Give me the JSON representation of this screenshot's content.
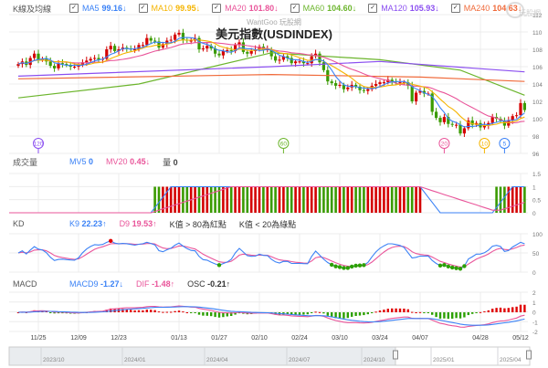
{
  "legend": {
    "label": "K線及均線",
    "items": [
      {
        "name": "MA5",
        "value": "99.16",
        "arrow": "↓",
        "color": "#3b82f6"
      },
      {
        "name": "MA10",
        "value": "99.95",
        "arrow": "↓",
        "color": "#f5b400"
      },
      {
        "name": "MA20",
        "value": "101.80",
        "arrow": "↓",
        "color": "#e9559a"
      },
      {
        "name": "MA60",
        "value": "104.60",
        "arrow": "↓",
        "color": "#6cb52d"
      },
      {
        "name": "MA120",
        "value": "105.93",
        "arrow": "↓",
        "color": "#8b4ff0"
      },
      {
        "name": "MA240",
        "value": "104.63",
        "arrow": "↓",
        "color": "#f06a3a"
      }
    ]
  },
  "logo": {
    "text": "玩股網"
  },
  "watermark": "WantGoo 玩股網",
  "title": "美元指數(USDINDEX)",
  "volume_header": {
    "label": "成交量",
    "mv5": {
      "name": "MV5",
      "value": "0",
      "arrow": "",
      "color": "#3b82f6"
    },
    "mv20": {
      "name": "MV20",
      "value": "0.45",
      "arrow": "↓",
      "color": "#e9559a"
    },
    "vol": {
      "name": "量",
      "value": "0",
      "arrow": "",
      "color": "#444"
    }
  },
  "kd_header": {
    "label": "KD",
    "k9": {
      "name": "K9",
      "value": "22.23",
      "arrow": "↑",
      "color": "#3b82f6"
    },
    "d9": {
      "name": "D9",
      "value": "19.53",
      "arrow": "↑",
      "color": "#e9559a"
    },
    "note_red": "K值 > 80為紅點",
    "note_green": "K值 < 20為綠點"
  },
  "macd_header": {
    "label": "MACD",
    "macd9": {
      "name": "MACD9",
      "value": "-1.27",
      "arrow": "↓",
      "color": "#3b82f6"
    },
    "dif": {
      "name": "DIF",
      "value": "-1.48",
      "arrow": "↑",
      "color": "#e9559a"
    },
    "osc": {
      "name": "OSC",
      "value": "-0.21",
      "arrow": "↑",
      "color": "#444"
    }
  },
  "colors": {
    "up": "#d40000",
    "down": "#3a9b00",
    "grid": "#ececec"
  },
  "chart_data": {
    "type": "candlestick",
    "y_ticks": [
      "112",
      "110",
      "108",
      "106",
      "104",
      "102",
      "100",
      "98",
      "96"
    ],
    "ylim": [
      96,
      112
    ],
    "closes": [
      106.3,
      106.6,
      106.2,
      107.0,
      107.5,
      106.8,
      106.9,
      106.6,
      106.1,
      105.8,
      106.4,
      106.3,
      106.2,
      106.0,
      106.0,
      106.2,
      106.5,
      106.7,
      106.9,
      107.0,
      106.8,
      106.9,
      108.0,
      108.4,
      107.8,
      108.0,
      108.2,
      108.1,
      108.0,
      108.0,
      108.5,
      108.5,
      109.3,
      109.0,
      108.9,
      108.2,
      108.6,
      109.0,
      109.1,
      109.7,
      109.9,
      109.1,
      109.0,
      109.0,
      109.3,
      108.0,
      108.1,
      108.4,
      108.1,
      107.5,
      107.3,
      107.8,
      107.9,
      107.8,
      108.5,
      108.8,
      107.7,
      107.5,
      107.8,
      108.0,
      108.3,
      107.9,
      108.0,
      107.2,
      106.7,
      106.8,
      107.2,
      107.0,
      106.4,
      106.6,
      106.6,
      106.4,
      106.4,
      107.2,
      107.5,
      106.5,
      105.6,
      104.3,
      104.1,
      103.8,
      103.9,
      103.4,
      103.6,
      103.9,
      103.7,
      103.3,
      103.2,
      103.4,
      103.8,
      104.0,
      104.2,
      104.2,
      104.5,
      104.3,
      104.2,
      104.2,
      104.2,
      103.8,
      102.0,
      103.0,
      103.2,
      102.9,
      102.9,
      100.8,
      100.1,
      99.6,
      100.2,
      99.4,
      99.3,
      99.3,
      98.3,
      98.9,
      99.8,
      99.3,
      99.5,
      99.0,
      99.2,
      99.5,
      100.2,
      100.0,
      99.8,
      99.2,
      99.8,
      100.3,
      100.4,
      101.8,
      101.0
    ],
    "long_ma": {
      "MA60": [
        [
          0,
          102.4
        ],
        [
          30,
          104.0
        ],
        [
          63,
          107.6
        ],
        [
          90,
          106.8
        ],
        [
          110,
          105.6
        ],
        [
          126,
          102.7
        ]
      ],
      "MA120": [
        [
          0,
          104.9
        ],
        [
          63,
          106.0
        ],
        [
          90,
          106.6
        ],
        [
          126,
          105.4
        ]
      ],
      "MA240": [
        [
          0,
          104.6
        ],
        [
          63,
          105.1
        ],
        [
          100,
          104.8
        ],
        [
          126,
          104.3
        ]
      ]
    },
    "ma_markers": [
      {
        "label": "120",
        "index": 5,
        "color": "#8b4ff0"
      },
      {
        "label": "60",
        "index": 66,
        "color": "#6cb52d"
      },
      {
        "label": "20",
        "index": 106,
        "color": "#e9559a"
      },
      {
        "label": "10",
        "index": 116,
        "color": "#f5b400"
      },
      {
        "label": "5",
        "index": 121,
        "color": "#3b82f6"
      }
    ],
    "volume": [
      0,
      0,
      0,
      0,
      0,
      0,
      0,
      0,
      0,
      0,
      0,
      0,
      0,
      0,
      0,
      0,
      0,
      0,
      0,
      0,
      0,
      0,
      0,
      0,
      0,
      0,
      0,
      0,
      0,
      0,
      0,
      0,
      0,
      0,
      1,
      1,
      1,
      1,
      1,
      1,
      1,
      1,
      1,
      1,
      1,
      1,
      1,
      1,
      1,
      1,
      1,
      1,
      1,
      1,
      1,
      1,
      1,
      1,
      1,
      1,
      1,
      1,
      1,
      1,
      1,
      1,
      1,
      1,
      1,
      1,
      1,
      1,
      1,
      1,
      1,
      1,
      1,
      1,
      1,
      1,
      1,
      1,
      1,
      1,
      1,
      1,
      1,
      1,
      1,
      1,
      1,
      1,
      1,
      1,
      1,
      1,
      1,
      1,
      1,
      1,
      1,
      0,
      0,
      0,
      0,
      0,
      0,
      0,
      0,
      0,
      0,
      0,
      0,
      0,
      0,
      0,
      0,
      0,
      0,
      1,
      1,
      1,
      1,
      1,
      1,
      1,
      1
    ],
    "volume_ticks": [
      "1.5",
      "1",
      "0.5",
      "0"
    ],
    "kd_ticks": [
      "100",
      "50",
      "0"
    ],
    "macd_ticks": [
      "2",
      "1",
      "0",
      "-1",
      "-2"
    ],
    "date_ticks": [
      {
        "label": "11/25",
        "index": 5
      },
      {
        "label": "12/09",
        "index": 15
      },
      {
        "label": "12/23",
        "index": 25
      },
      {
        "label": "01/13",
        "index": 40
      },
      {
        "label": "01/27",
        "index": 50
      },
      {
        "label": "02/10",
        "index": 60
      },
      {
        "label": "02/24",
        "index": 70
      },
      {
        "label": "03/10",
        "index": 80
      },
      {
        "label": "03/24",
        "index": 90
      },
      {
        "label": "04/07",
        "index": 100
      },
      {
        "label": "04/28",
        "index": 115
      },
      {
        "label": "05/12",
        "index": 125
      }
    ]
  },
  "navigator": {
    "labels": [
      "2023/10",
      "2024/01",
      "2024/04",
      "2024/07",
      "2024/10",
      "2025/01",
      "2025/04"
    ]
  }
}
